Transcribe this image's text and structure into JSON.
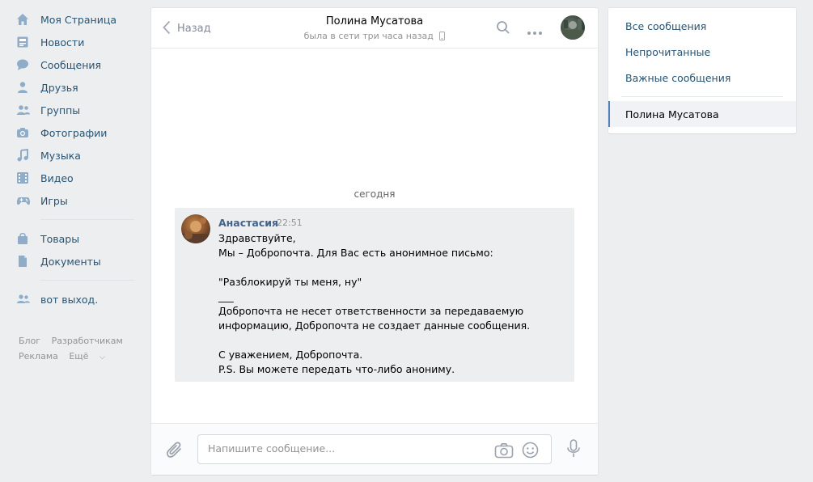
{
  "nav": {
    "items": [
      {
        "label": "Моя Страница",
        "icon": "home-icon"
      },
      {
        "label": "Новости",
        "icon": "news-icon"
      },
      {
        "label": "Сообщения",
        "icon": "messages-icon"
      },
      {
        "label": "Друзья",
        "icon": "friends-icon"
      },
      {
        "label": "Группы",
        "icon": "groups-icon"
      },
      {
        "label": "Фотографии",
        "icon": "camera-icon"
      },
      {
        "label": "Музыка",
        "icon": "music-icon"
      },
      {
        "label": "Видео",
        "icon": "video-icon"
      },
      {
        "label": "Игры",
        "icon": "gamepad-icon"
      },
      {
        "label": "Товары",
        "icon": "shopping-bag-icon"
      },
      {
        "label": "Документы",
        "icon": "document-icon"
      },
      {
        "label": "вот выход.",
        "icon": "community-icon"
      }
    ],
    "footer": {
      "blog": "Блог",
      "developers": "Разработчикам",
      "ads": "Реклама",
      "more": "Ещё"
    }
  },
  "chat": {
    "back_label": "Назад",
    "peer_name": "Полина Мусатова",
    "peer_status": "была в сети три часа назад",
    "date_separator": "сегодня",
    "message": {
      "author": "Анастасия",
      "time": "22:51",
      "text": "Здравствуйте,\nМы – Добропочта. Для Вас есть анонимное письмо:\n\n\"Разблокируй ты меня, ну\"\n___\nДобропочта не несет ответственности за передаваемую информацию, Добропочта не создает данные сообщения.\n\nС уважением, Добропочта.\nP.S. Вы можете передать что-либо анониму."
    },
    "composer_placeholder": "Напишите сообщение..."
  },
  "right_panel": {
    "items": [
      "Все сообщения",
      "Непрочитанные",
      "Важные сообщения"
    ],
    "active_chat": "Полина Мусатова"
  },
  "colors": {
    "link": "#285473",
    "accent": "#5181b8",
    "icon": "#8fadc8"
  }
}
